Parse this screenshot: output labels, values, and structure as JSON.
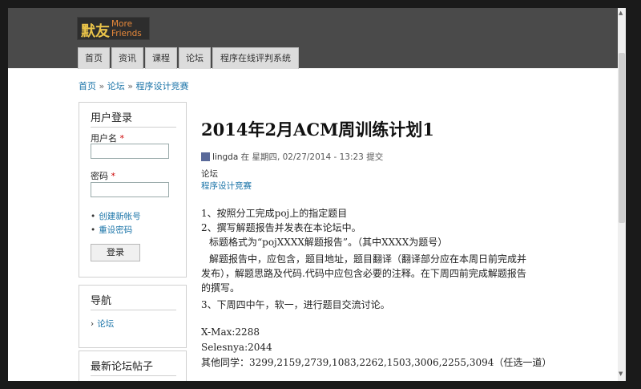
{
  "site": {
    "logo_cn": "默友",
    "logo_en_1": "More",
    "logo_en_2": "Friends"
  },
  "nav": [
    {
      "label": "首页"
    },
    {
      "label": "资讯"
    },
    {
      "label": "课程"
    },
    {
      "label": "论坛"
    },
    {
      "label": "程序在线评判系统"
    }
  ],
  "breadcrumb": {
    "home": "首页",
    "sep": "»",
    "forum": "论坛",
    "board": "程序设计竞赛"
  },
  "login": {
    "title": "用户登录",
    "username_label": "用户名",
    "password_label": "密码",
    "required_mark": "*",
    "bullet": "•",
    "create_account": "创建新帐号",
    "reset_password": "重设密码",
    "submit": "登录"
  },
  "navigation": {
    "title": "导航",
    "marker": "›",
    "item": "论坛"
  },
  "recent": {
    "title": "最新论坛帖子"
  },
  "post": {
    "title": "2014年2月ACM周训练计划1",
    "author": "lingda",
    "meta_rest": "在 星期四, 02/27/2014 - 13:23 提交",
    "tag_label": "论坛",
    "tag_link": "程序设计竞赛",
    "lines": [
      "1、按照分工完成poj上的指定题目",
      "2、撰写解题报告并发表在本论坛中。",
      "标题格式为“pojXXXX解题报告”。（其中XXXX为题号）",
      "解题报告中，应包含，题目地址，题目翻译（翻译部分应在本周日前完成并",
      "发布），解题思路及代码.代码中应包含必要的注释。在下周四前完成解题报告",
      "的撰写。",
      "3、下周四中午，软一，进行题目交流讨论。"
    ],
    "stats": [
      "X-Max:2288",
      "Selesnya:2044",
      "其他同学：3299,2159,2739,1083,2262,1503,3006,2255,3094（任选一道）"
    ]
  },
  "scrollbar": {
    "up": "▲",
    "down": "▼"
  }
}
